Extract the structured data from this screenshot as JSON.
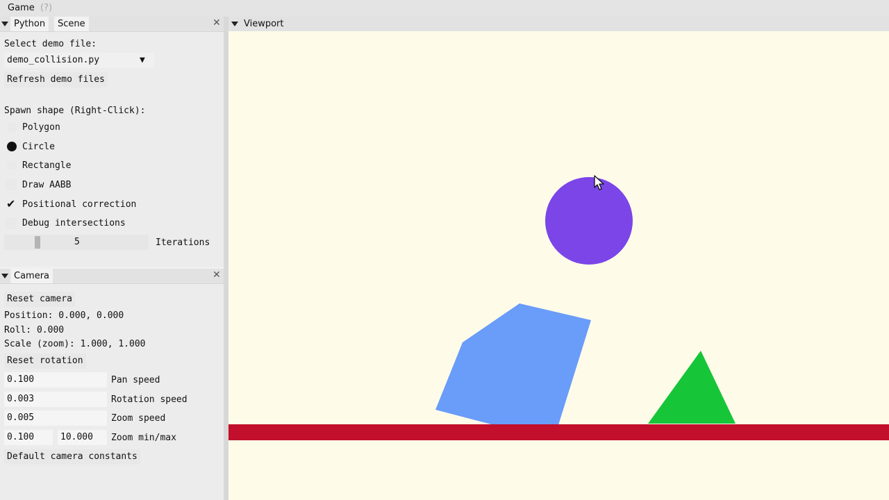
{
  "menubar": {
    "game": "Game",
    "help": "(?)"
  },
  "python_panel": {
    "tabs": [
      "Python",
      "Scene"
    ],
    "select_label": "Select demo file:",
    "selected_file": "demo_collision.py",
    "refresh_button": "Refresh demo files",
    "spawn_label": "Spawn shape (Right-Click):",
    "shapes": [
      {
        "label": "Polygon",
        "selected": false
      },
      {
        "label": "Circle",
        "selected": true
      },
      {
        "label": "Rectangle",
        "selected": false
      }
    ],
    "options": [
      {
        "label": "Draw AABB",
        "checked": false
      },
      {
        "label": "Positional correction",
        "checked": true
      },
      {
        "label": "Debug intersections",
        "checked": false
      }
    ],
    "iterations_value": "5",
    "iterations_label": "Iterations"
  },
  "camera_panel": {
    "title": "Camera",
    "reset_camera": "Reset camera",
    "position": "Position: 0.000, 0.000",
    "roll": "Roll: 0.000",
    "scale": "Scale (zoom): 1.000, 1.000",
    "reset_rotation": "Reset rotation",
    "pan_speed_value": "0.100",
    "pan_speed_label": "Pan speed",
    "rotation_speed_value": "0.003",
    "rotation_speed_label": "Rotation speed",
    "zoom_speed_value": "0.005",
    "zoom_speed_label": "Zoom speed",
    "zoom_min": "0.100",
    "zoom_max": "10.000",
    "zoom_minmax_label": "Zoom min/max",
    "default_constants": "Default camera constants"
  },
  "viewport": {
    "title": "Viewport"
  },
  "colors": {
    "viewport_bg": "#fefce9",
    "circle": "#7b45e8",
    "polygon": "#6a9cf9",
    "triangle": "#17c539",
    "ground": "#c10f2c"
  }
}
